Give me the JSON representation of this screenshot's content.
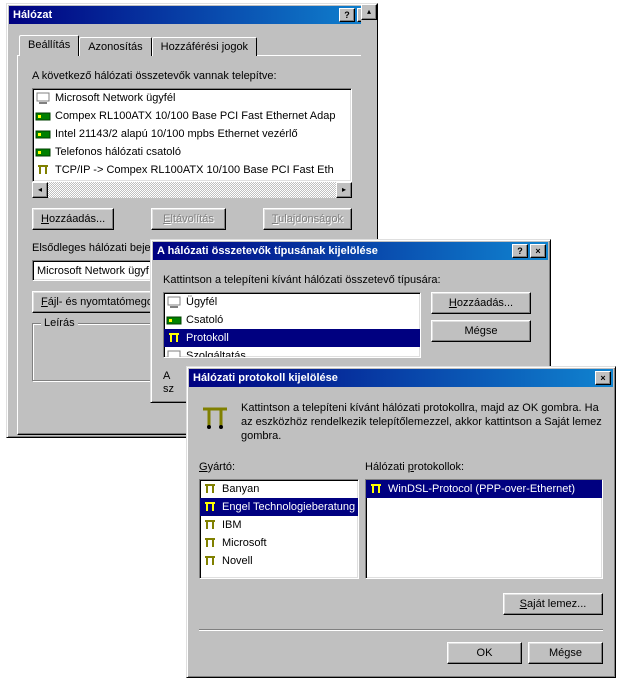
{
  "window1": {
    "title": "Hálózat",
    "tabs": [
      "Beállítás",
      "Azonosítás",
      "Hozzáférési jogok"
    ],
    "components_label": "A következő hálózati összetevők vannak telepítve:",
    "components": [
      {
        "icon": "client",
        "label": "Microsoft Network ügyfél"
      },
      {
        "icon": "adapter",
        "label": "Compex RL100ATX 10/100 Base PCI Fast Ethernet Adap"
      },
      {
        "icon": "adapter",
        "label": "Intel 21143/2 alapú 10/100 mpbs Ethernet vezérlő"
      },
      {
        "icon": "adapter",
        "label": "Telefonos hálózati csatoló"
      },
      {
        "icon": "protocol",
        "label": "TCP/IP -> Compex RL100ATX 10/100 Base PCI Fast Eth"
      }
    ],
    "add_btn": "Hozzáadás...",
    "remove_btn": "Eltávolítás",
    "props_btn": "Tulajdonságok",
    "primary_logon_label": "Elsődleges hálózati bejel",
    "primary_logon_value": "Microsoft Network ügyf",
    "file_btn": "Fájl- és nyomtatómego",
    "desc_label": "Leírás"
  },
  "window2": {
    "title": "A hálózati összetevők típusának kijelölése",
    "instruction": "Kattintson a telepíteni kívánt hálózati összetevő típusára:",
    "types": [
      {
        "icon": "client",
        "label": "Ügyfél"
      },
      {
        "icon": "adapter",
        "label": "Csatoló"
      },
      {
        "icon": "protocol",
        "label": "Protokoll",
        "selected": true
      },
      {
        "icon": "service",
        "label": "Szolgáltatás"
      }
    ],
    "add_btn": "Hozzáadás...",
    "cancel_btn": "Mégse",
    "partial_text": "A\nsz"
  },
  "window3": {
    "title": "Hálózati protokoll kijelölése",
    "instruction": "Kattintson a telepíteni kívánt hálózati protokollra, majd az OK gombra. Ha az eszközhöz rendelkezik telepítőlemezzel, akkor kattintson a Saját lemez gombra.",
    "manufacturer_label": "Gyártó:",
    "protocols_label": "Hálózati protokollok:",
    "manufacturers": [
      {
        "label": "Banyan"
      },
      {
        "label": "Engel Technologieberatung",
        "selected": true
      },
      {
        "label": "IBM"
      },
      {
        "label": "Microsoft"
      },
      {
        "label": "Novell"
      }
    ],
    "protocols": [
      {
        "label": "WinDSL-Protocol (PPP-over-Ethernet)",
        "selected": true
      }
    ],
    "disk_btn": "Saját lemez...",
    "ok_btn": "OK",
    "cancel_btn": "Mégse"
  }
}
